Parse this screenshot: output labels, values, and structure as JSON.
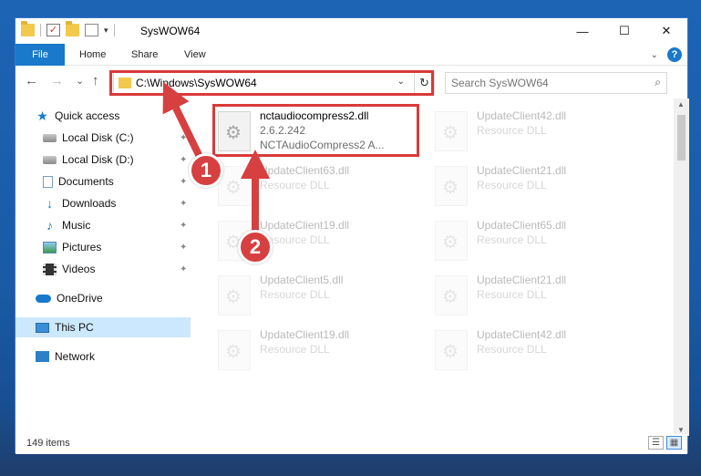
{
  "window": {
    "title": "SysWOW64",
    "controls": {
      "minimize": "—",
      "maximize": "☐",
      "close": "✕"
    }
  },
  "ribbon": {
    "tabs": [
      "File",
      "Home",
      "Share",
      "View"
    ],
    "expand_icon": "chevron-down-icon",
    "help_label": "?"
  },
  "nav": {
    "back_icon": "←",
    "forward_icon": "→",
    "recent_icon": "⌄",
    "up_icon": "↑",
    "address_path": "C:\\Windows\\SysWOW64",
    "address_dropdown": "⌄",
    "refresh_icon": "↻",
    "search_placeholder": "Search SysWOW64",
    "search_icon": "⌕"
  },
  "sidebar": {
    "items": [
      {
        "label": "Quick access",
        "icon": "star-icon",
        "pinned": false
      },
      {
        "label": "Local Disk (C:)",
        "icon": "drive-icon",
        "pinned": true
      },
      {
        "label": "Local Disk (D:)",
        "icon": "drive-icon",
        "pinned": true
      },
      {
        "label": "Documents",
        "icon": "document-icon",
        "pinned": true
      },
      {
        "label": "Downloads",
        "icon": "download-icon",
        "pinned": true
      },
      {
        "label": "Music",
        "icon": "music-icon",
        "pinned": true
      },
      {
        "label": "Pictures",
        "icon": "pictures-icon",
        "pinned": true
      },
      {
        "label": "Videos",
        "icon": "videos-icon",
        "pinned": true
      },
      {
        "label": "OneDrive",
        "icon": "cloud-icon",
        "pinned": false
      },
      {
        "label": "This PC",
        "icon": "computer-icon",
        "pinned": false,
        "selected": true
      },
      {
        "label": "Network",
        "icon": "network-icon",
        "pinned": false
      }
    ],
    "pin_glyph": "📌"
  },
  "files": [
    {
      "name": "nctaudiocompress2.dll",
      "line2": "2.6.2.242",
      "line3": "NCTAudioCompress2 A...",
      "highlighted": true
    },
    {
      "name": "UpdateClient42.dll",
      "line2": "Resource DLL",
      "line3": ""
    },
    {
      "name": "UpdateClient63.dll",
      "line2": "Resource DLL",
      "line3": ""
    },
    {
      "name": "UpdateClient21.dll",
      "line2": "Resource DLL",
      "line3": ""
    },
    {
      "name": "UpdateClient19.dll",
      "line2": "Resource DLL",
      "line3": ""
    },
    {
      "name": "UpdateClient65.dll",
      "line2": "Resource DLL",
      "line3": ""
    },
    {
      "name": "UpdateClient5.dll",
      "line2": "Resource DLL",
      "line3": ""
    },
    {
      "name": "UpdateClient21.dll",
      "line2": "Resource DLL",
      "line3": ""
    },
    {
      "name": "UpdateClient19.dll",
      "line2": "Resource DLL",
      "line3": ""
    },
    {
      "name": "UpdateClient42.dll",
      "line2": "Resource DLL",
      "line3": ""
    }
  ],
  "status": {
    "item_count": "149 items",
    "view_details": "☰",
    "view_tiles": "▦"
  },
  "annotations": {
    "step1": "1",
    "step2": "2",
    "highlight_color": "#d93a3a"
  }
}
